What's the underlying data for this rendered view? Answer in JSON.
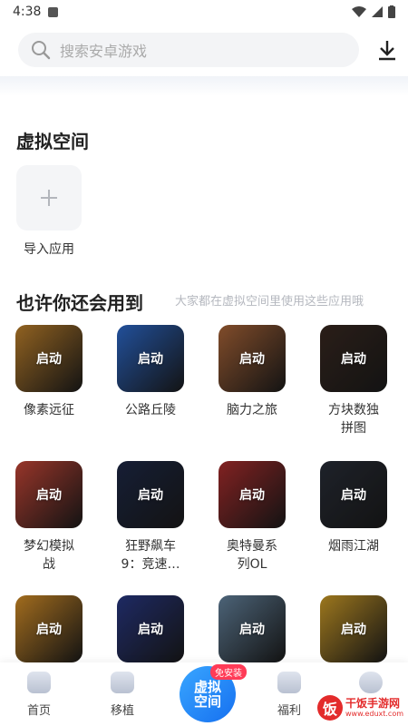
{
  "status_bar": {
    "time": "4:38"
  },
  "search": {
    "placeholder": "搜索安卓游戏"
  },
  "virtual_space": {
    "title": "虚拟空间",
    "import_label": "导入应用"
  },
  "recommend": {
    "title": "也许你还会用到",
    "hint": "大家都在虚拟空间里使用这些应用哦",
    "launch_label": "启动",
    "apps": [
      {
        "name_line1": "像素远征",
        "name_line2": "",
        "color": "#c9882e"
      },
      {
        "name_line1": "公路丘陵",
        "name_line2": "",
        "color": "#2f6fd6"
      },
      {
        "name_line1": "脑力之旅",
        "name_line2": "",
        "color": "#b36a3b"
      },
      {
        "name_line1": "方块数独",
        "name_line2": "拼图",
        "color": "#3b2a22"
      },
      {
        "name_line1": "梦幻模拟",
        "name_line2": "战",
        "color": "#d24a3a"
      },
      {
        "name_line1": "狂野飙车",
        "name_line2": "9：竞速…",
        "color": "#1f2a4a"
      },
      {
        "name_line1": "奥特曼系",
        "name_line2": "列OL",
        "color": "#b42f2f"
      },
      {
        "name_line1": "烟雨江湖",
        "name_line2": "",
        "color": "#2a2f3a"
      },
      {
        "name_line1": "",
        "name_line2": "",
        "color": "#e0962a"
      },
      {
        "name_line1": "",
        "name_line2": "",
        "color": "#2a3a8a"
      },
      {
        "name_line1": "",
        "name_line2": "",
        "color": "#6a8aa6"
      },
      {
        "name_line1": "",
        "name_line2": "",
        "color": "#d9a52a"
      }
    ]
  },
  "tabbar": {
    "home": "首页",
    "port": "移植",
    "center_label": "虚拟空间",
    "center_badge": "免安装",
    "welfare": "福利"
  },
  "watermark": {
    "name": "干饭手游网",
    "url": "www.eduxt.com",
    "logo_char": "饭"
  },
  "colors": {
    "accent": "#1670f0",
    "badge": "#ff3b57"
  }
}
